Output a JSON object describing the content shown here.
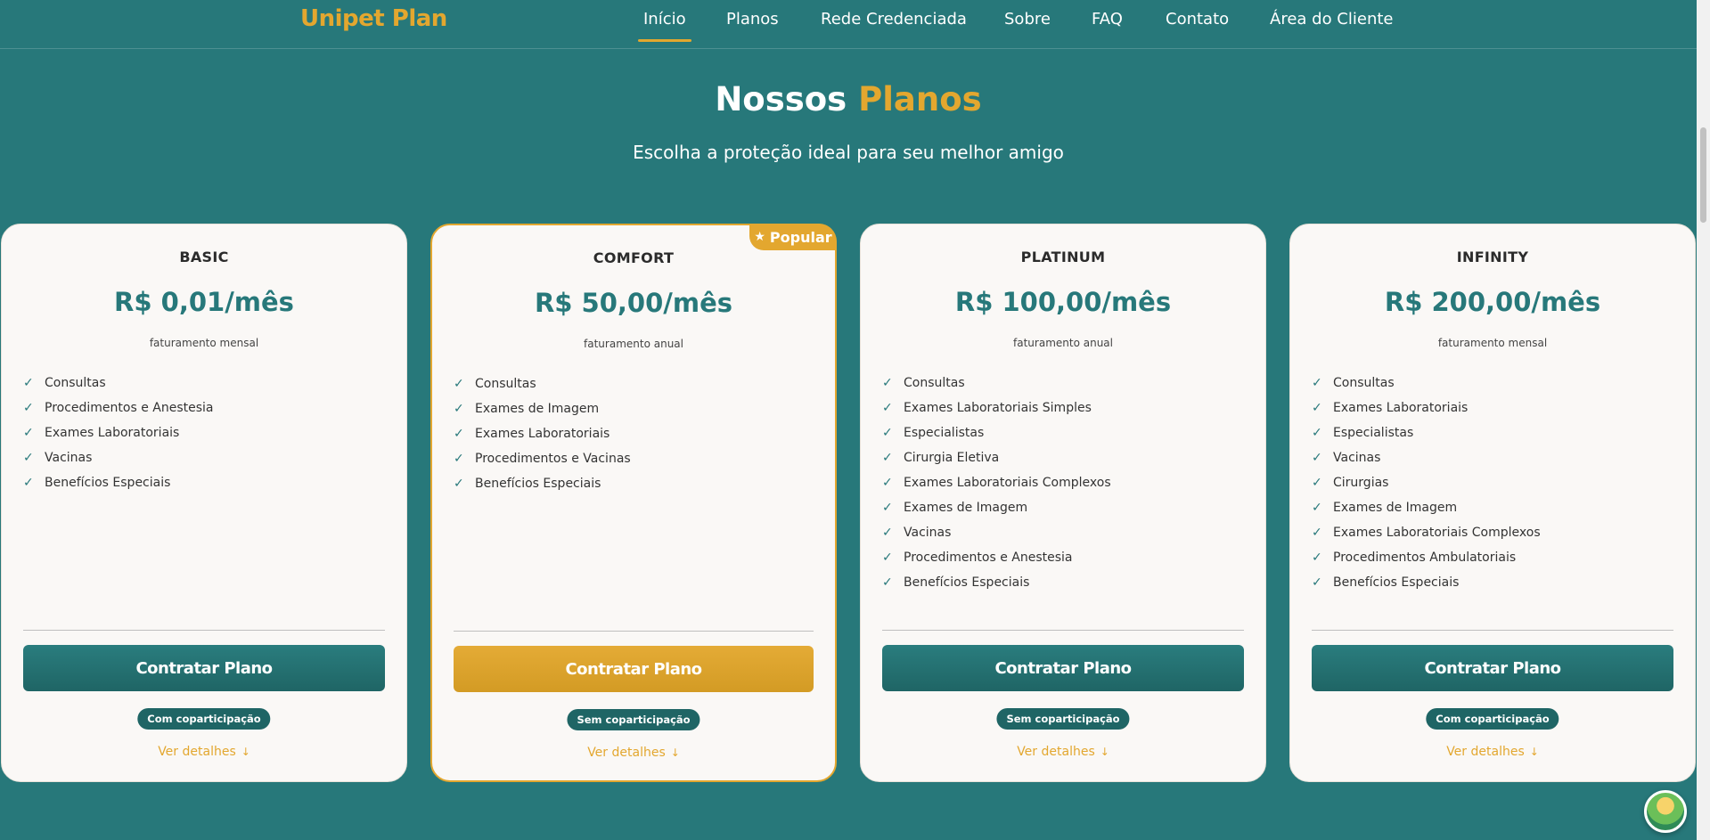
{
  "header": {
    "logo": "Unipet Plan",
    "nav": [
      {
        "label": "Início"
      },
      {
        "label": "Planos"
      },
      {
        "label": "Rede Credenciada"
      },
      {
        "label": "Sobre"
      },
      {
        "label": "FAQ"
      },
      {
        "label": "Contato"
      },
      {
        "label": "Área do Cliente"
      }
    ]
  },
  "section": {
    "title_part1": "Nossos",
    "title_part2": "Planos",
    "subtitle": "Escolha a proteção ideal para seu melhor amigo"
  },
  "plans": [
    {
      "name": "BASIC",
      "price": "R$ 0,01/mês",
      "billing": "faturamento mensal",
      "features": [
        "Consultas",
        "Procedimentos e Anestesia",
        "Exames Laboratoriais",
        "Vacinas",
        "Benefícios Especiais"
      ],
      "cta": "Contratar Plano",
      "copay": "Com coparticipação",
      "details": "Ver detalhes"
    },
    {
      "name": "COMFORT",
      "badge": "Popular",
      "price": "R$ 50,00/mês",
      "billing": "faturamento anual",
      "features": [
        "Consultas",
        "Exames de Imagem",
        "Exames Laboratoriais",
        "Procedimentos e Vacinas",
        "Benefícios Especiais"
      ],
      "cta": "Contratar Plano",
      "copay": "Sem coparticipação",
      "details": "Ver detalhes"
    },
    {
      "name": "PLATINUM",
      "price": "R$ 100,00/mês",
      "billing": "faturamento anual",
      "features": [
        "Consultas",
        "Exames Laboratoriais Simples",
        "Especialistas",
        "Cirurgia Eletiva",
        "Exames Laboratoriais Complexos",
        "Exames de Imagem",
        "Vacinas",
        "Procedimentos e Anestesia",
        "Benefícios Especiais"
      ],
      "cta": "Contratar Plano",
      "copay": "Sem coparticipação",
      "details": "Ver detalhes"
    },
    {
      "name": "INFINITY",
      "price": "R$ 200,00/mês",
      "billing": "faturamento mensal",
      "features": [
        "Consultas",
        "Exames Laboratoriais",
        "Especialistas",
        "Vacinas",
        "Cirurgias",
        "Exames de Imagem",
        "Exames Laboratoriais Complexos",
        "Procedimentos Ambulatoriais",
        "Benefícios Especiais"
      ],
      "cta": "Contratar Plano",
      "copay": "Com coparticipação",
      "details": "Ver detalhes"
    }
  ],
  "colors": {
    "background": "#27787a",
    "accent": "#e3a72f",
    "card": "#faf8f6",
    "button": "#1f6565"
  }
}
